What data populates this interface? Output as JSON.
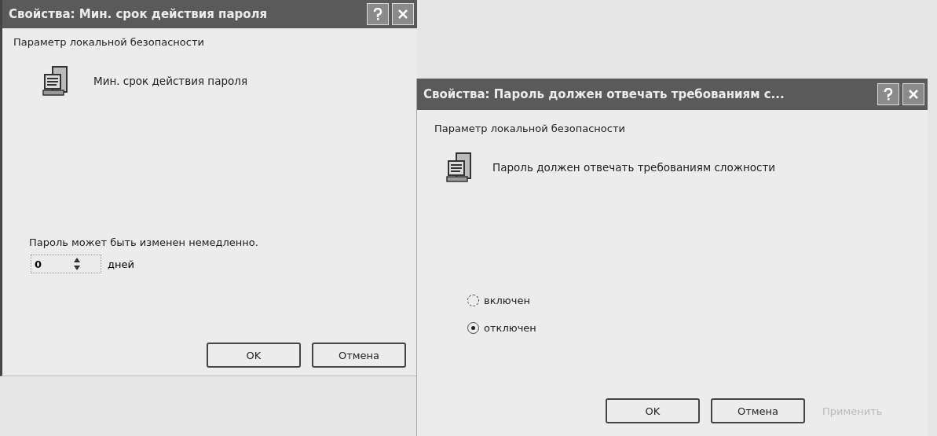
{
  "dialogs": [
    {
      "kind": "spinner",
      "title": "Свойства: Мин. срок действия пароля",
      "group_label": "Параметр локальной безопасности",
      "policy_name": "Мин. срок действия пароля",
      "description": "Пароль может быть изменен немедленно.",
      "spinner": {
        "value": "0",
        "unit": "дней"
      },
      "buttons": [
        {
          "label": "OK",
          "disabled": false
        },
        {
          "label": "Отмена",
          "disabled": false
        }
      ]
    },
    {
      "kind": "radio",
      "title": "Свойства: Пароль должен отвечать требованиям с...",
      "group_label": "Параметр локальной безопасности",
      "policy_name": "Пароль должен отвечать требованиям сложности",
      "options": [
        {
          "label": "включен",
          "selected": false
        },
        {
          "label": "отключен",
          "selected": true
        }
      ],
      "buttons": [
        {
          "label": "OK",
          "disabled": false
        },
        {
          "label": "Отмена",
          "disabled": false
        },
        {
          "label": "Применить",
          "disabled": true
        }
      ]
    }
  ]
}
